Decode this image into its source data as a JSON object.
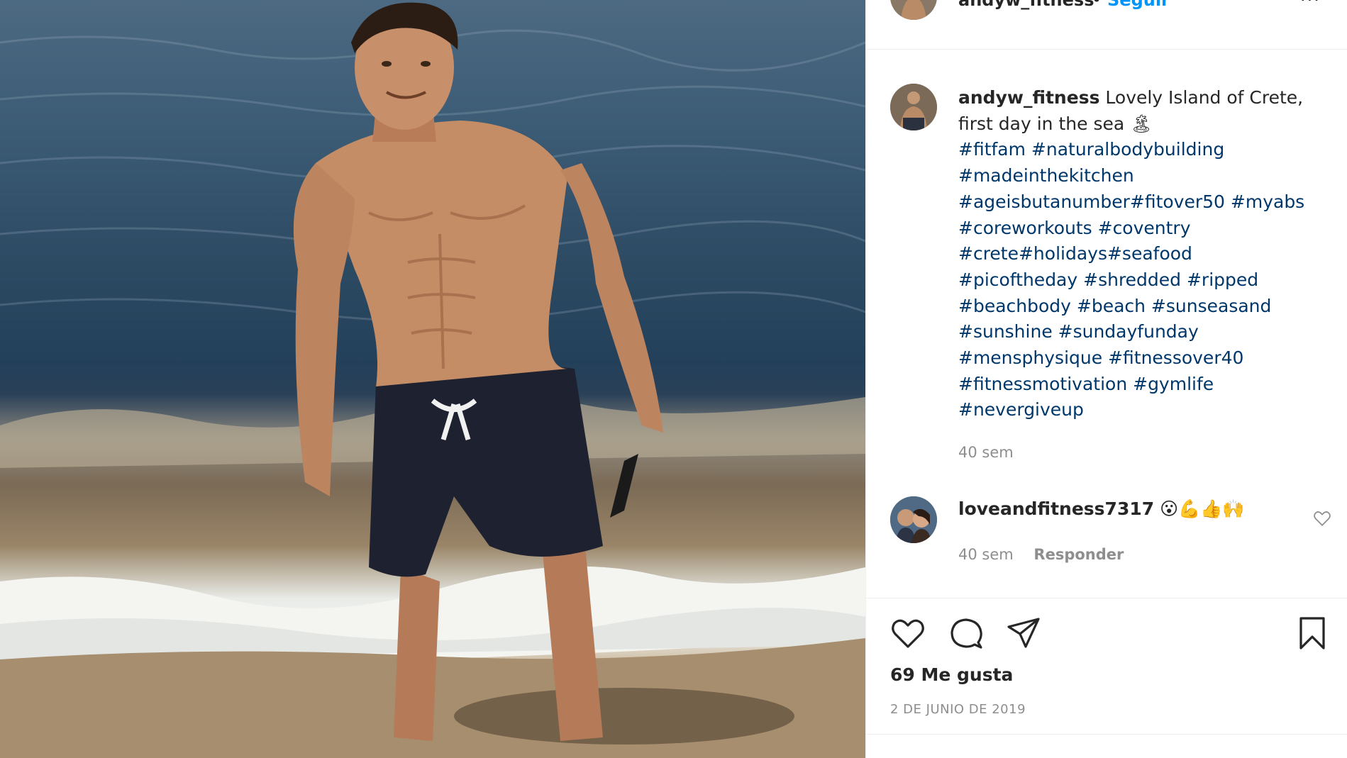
{
  "post": {
    "author": {
      "username": "andyw_fitness",
      "follow_label": "Seguir",
      "separator": "•",
      "more_label": "···"
    },
    "caption": {
      "username": "andyw_fitness",
      "text": "Lovely Island of Crete, first day in the sea 🏝",
      "hashtag_lines": [
        "#fitfam #naturalbodybuilding",
        "#madeinthekitchen",
        "#ageisbutanumber#fitover50 #myabs",
        "#coreworkouts #coventry",
        "#crete#holidays#seafood",
        "#picoftheday #shredded #ripped",
        "#beachbody #beach #sunseasand",
        "#sunshine #sundayfunday",
        "#mensphysique #fitnessover40",
        "#fitnessmotivation #gymlife",
        "#nevergiveup"
      ],
      "time": "40 sem"
    },
    "comments": [
      {
        "username": "loveandfitness7317",
        "text": "😮💪👍🙌",
        "time": "40 sem",
        "reply_label": "Responder"
      }
    ],
    "likes": "69 Me gusta",
    "date": "2 DE JUNIO DE 2019"
  },
  "icons": {
    "like": "heart-icon",
    "comment": "comment-icon",
    "share": "send-icon",
    "save": "bookmark-icon"
  },
  "colors": {
    "link": "#0095f6",
    "hashtag": "#00376b",
    "muted": "#8e8e8e",
    "text": "#262626"
  }
}
